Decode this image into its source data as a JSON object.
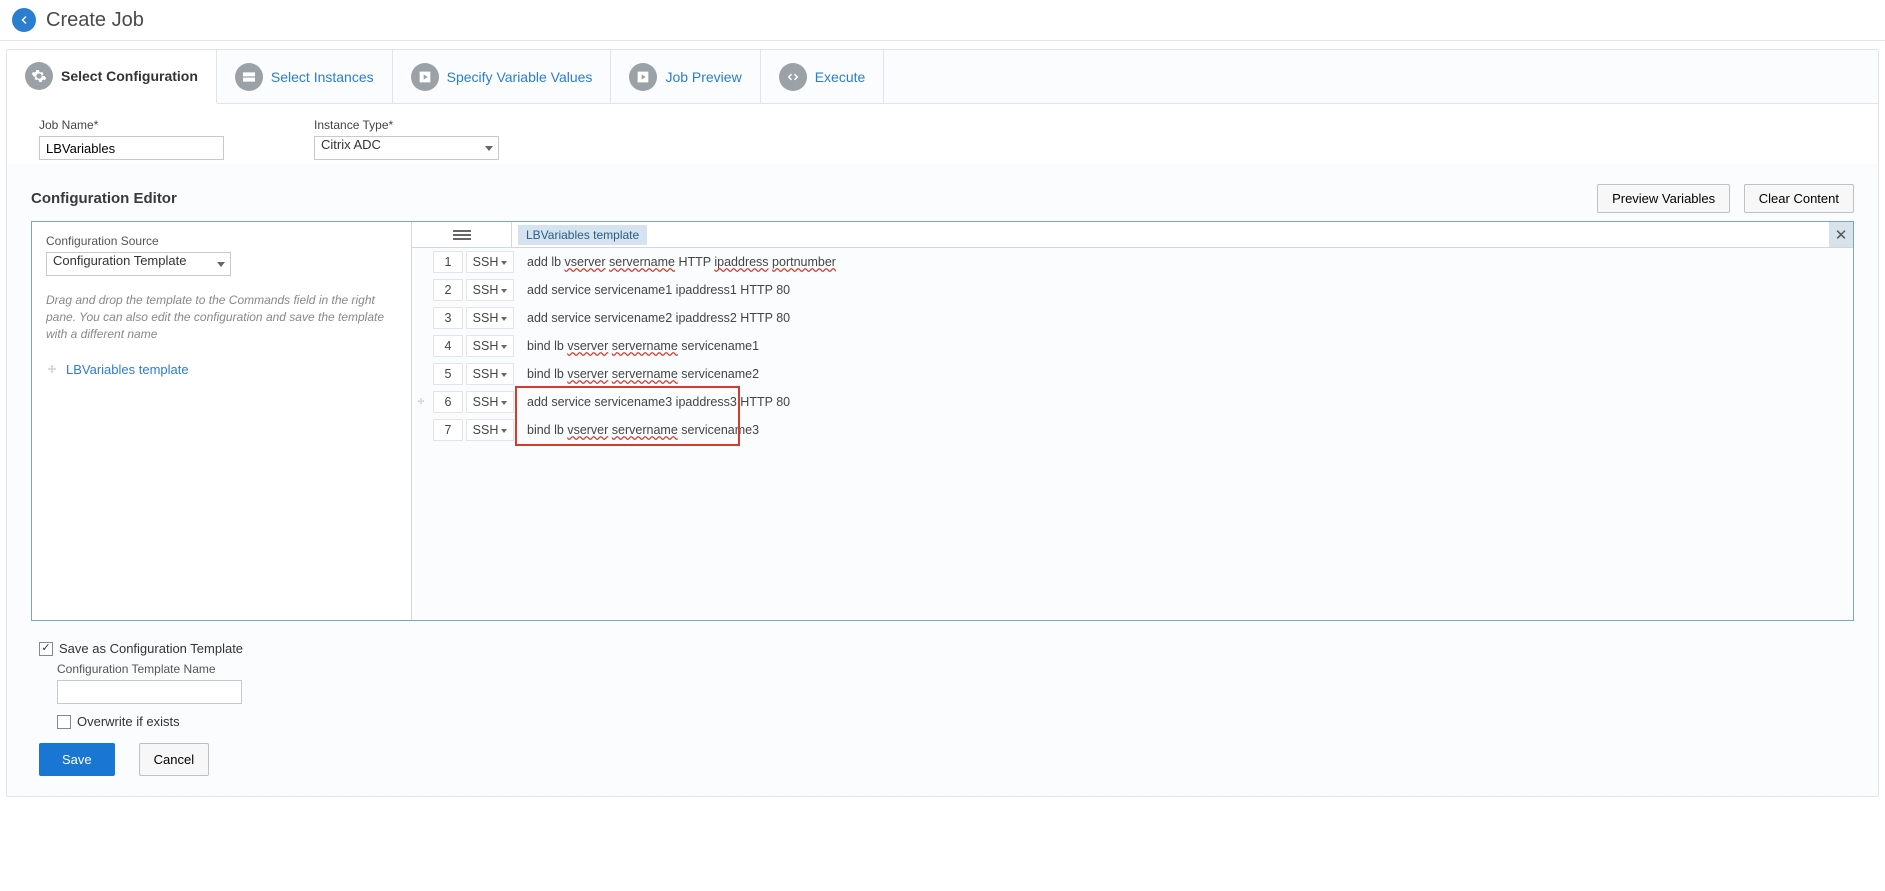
{
  "pageTitle": "Create Job",
  "wizardTabs": [
    {
      "label": "Select Configuration"
    },
    {
      "label": "Select Instances"
    },
    {
      "label": "Specify Variable Values"
    },
    {
      "label": "Job Preview"
    },
    {
      "label": "Execute"
    }
  ],
  "jobNameLabel": "Job Name*",
  "jobNameValue": "LBVariables",
  "instanceTypeLabel": "Instance Type*",
  "instanceTypeValue": "Citrix ADC",
  "editorTitle": "Configuration Editor",
  "previewBtn": "Preview Variables",
  "clearBtn": "Clear Content",
  "configSourceLabel": "Configuration Source",
  "configSourceValue": "Configuration Template",
  "helpText": "Drag and drop the template to the Commands field in the right pane. You can also edit the configuration and save the template with a different name",
  "templateItem": "LBVariables template",
  "editorTabChip": "LBVariables template",
  "commands": [
    {
      "n": 1,
      "mode": "SSH",
      "text": "add lb ",
      "sq1": "vserver",
      "mid": " ",
      "sq2": "servername",
      "mid2": " HTTP ",
      "sq3": "ipaddress",
      "mid3": " ",
      "sq4": "portnumber",
      "tail": ""
    },
    {
      "n": 2,
      "mode": "SSH",
      "plain": "add service servicename1 ipaddress1 HTTP 80"
    },
    {
      "n": 3,
      "mode": "SSH",
      "plain": "add service servicename2 ipaddress2 HTTP 80"
    },
    {
      "n": 4,
      "mode": "SSH",
      "text": "bind lb ",
      "sq1": "vserver",
      "mid": " ",
      "sq2": "servername",
      "tail": " servicename1"
    },
    {
      "n": 5,
      "mode": "SSH",
      "text": "bind lb ",
      "sq1": "vserver",
      "mid": " ",
      "sq2": "servername",
      "tail": " servicename2"
    },
    {
      "n": 6,
      "mode": "SSH",
      "plain": "add service servicename3 ipaddress3 HTTP 80",
      "drag": true,
      "hl": true
    },
    {
      "n": 7,
      "mode": "SSH",
      "text": "bind lb ",
      "sq1": "vserver",
      "mid": " ",
      "sq2": "servername",
      "tail": " servicename3",
      "hl": true
    }
  ],
  "saveAsTemplateLabel": "Save as Configuration Template",
  "templateNameLabel": "Configuration Template Name",
  "templateNameValue": "",
  "overwriteLabel": "Overwrite if exists",
  "saveBtn": "Save",
  "cancelBtn": "Cancel"
}
